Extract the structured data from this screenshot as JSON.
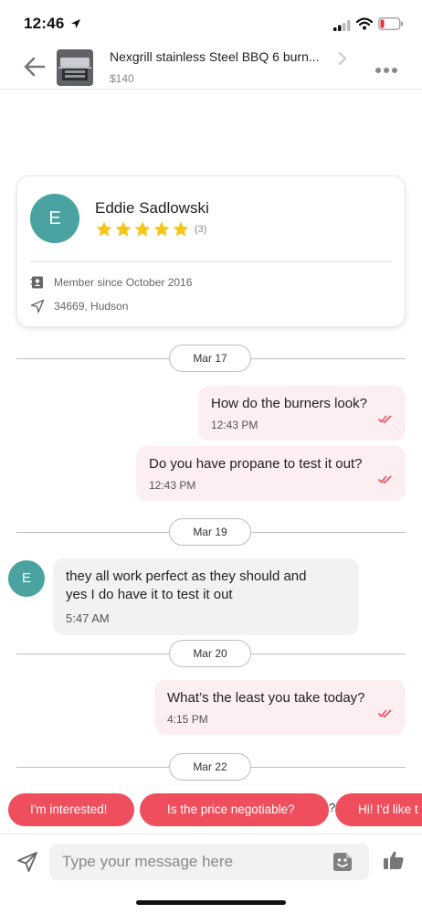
{
  "status_bar": {
    "time": "12:46"
  },
  "header": {
    "title": "Nexgrill stainless Steel BBQ 6 burn...",
    "price": "$140"
  },
  "seller": {
    "initial": "E",
    "name": "Eddie Sadlowski",
    "rating_stars": 5,
    "rating_count": "(3)",
    "member_since": "Member since October 2016",
    "location": "34669, Hudson"
  },
  "conversation": [
    {
      "date": "Mar 17"
    },
    {
      "direction": "out",
      "text": "How do the burners look?",
      "time": "12:43 PM"
    },
    {
      "direction": "out",
      "text": "Do you have propane to test it out?",
      "time": "12:43 PM"
    },
    {
      "date": "Mar 19"
    },
    {
      "direction": "in",
      "avatar": "E",
      "text_line1": "they all work perfect as they should and",
      "text_line2": "yes I do have it to test it out",
      "time": "5:47 AM"
    },
    {
      "date": "Mar 20"
    },
    {
      "direction": "out",
      "text": "What’s the least you take today?",
      "time": "4:15 PM"
    },
    {
      "date": "Mar 22"
    }
  ],
  "quick_replies": [
    "I'm interested!",
    "Is the price negotiable?",
    "Hi! I'd like t"
  ],
  "quick_reply_tail": "?",
  "composer": {
    "placeholder": "Type your message here"
  },
  "colors": {
    "accent": "#ef4f5d",
    "avatar": "#4aa3a0",
    "outgoing_bubble": "#fdeef1",
    "incoming_bubble": "#f2f2f2",
    "star": "#f5c518"
  }
}
